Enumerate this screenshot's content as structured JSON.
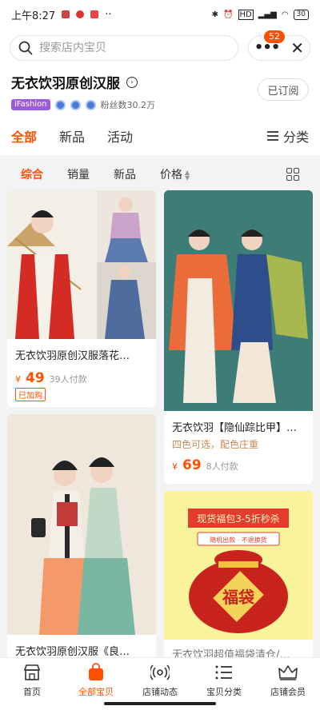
{
  "status_bar": {
    "time": "上午8:27",
    "battery": "30"
  },
  "search": {
    "placeholder": "搜索店内宝贝"
  },
  "actions": {
    "badge_count": "52"
  },
  "store": {
    "name": "无衣饮羽原创汉服",
    "tag": "iFashion",
    "fans": "粉丝数30.2万",
    "subscribe_label": "已订阅"
  },
  "tabs": [
    {
      "label": "全部",
      "active": true
    },
    {
      "label": "新品"
    },
    {
      "label": "活动"
    }
  ],
  "category_label": "分类",
  "sort": [
    {
      "label": "综合",
      "active": true
    },
    {
      "label": "销量"
    },
    {
      "label": "新品"
    },
    {
      "label": "价格"
    }
  ],
  "products": [
    {
      "title": "无衣饮羽原创汉服落花…",
      "currency": "¥",
      "price": "49",
      "sold": "39人付款",
      "tag": "已加购"
    },
    {
      "title": "无衣饮羽【隐仙踪比甲】…",
      "subtitle": "四色可选，配色庄重",
      "currency": "¥",
      "price": "69",
      "sold": "8人付款"
    },
    {
      "title": "无衣饮羽原创汉服《良…"
    },
    {
      "banner_top": "现货福包3-5折秒杀",
      "banner_mid": "随机出款 · 不退换货",
      "bag_text": "福袋",
      "title": "无衣饮羽超值福袋清仓/…"
    }
  ],
  "tabbar": [
    {
      "label": "首页"
    },
    {
      "label": "全部宝贝",
      "active": true
    },
    {
      "label": "店铺动态"
    },
    {
      "label": "宝贝分类"
    },
    {
      "label": "店铺会员"
    }
  ],
  "colors": {
    "accent": "#ff5000",
    "background": "#f3f3f3"
  }
}
